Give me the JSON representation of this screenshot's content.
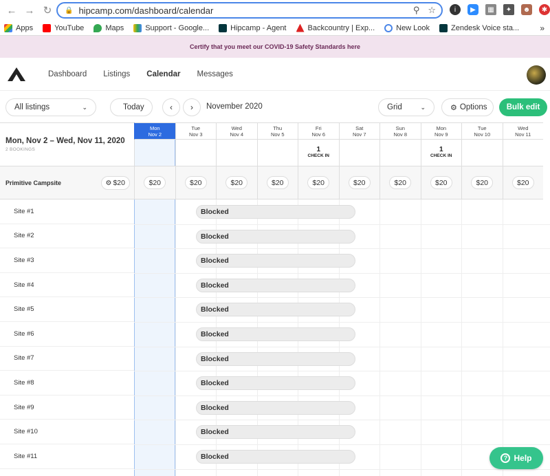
{
  "browser": {
    "url": "hipcamp.com/dashboard/calendar",
    "bookmarks": [
      "Apps",
      "YouTube",
      "Maps",
      "Support - Google...",
      "Hipcamp - Agent",
      "Backcountry | Exp...",
      "New Look",
      "Zendesk Voice sta..."
    ]
  },
  "banner": {
    "text": "Certify that you meet our COVID-19 Safety Standards here"
  },
  "nav": {
    "items": [
      "Dashboard",
      "Listings",
      "Calendar",
      "Messages"
    ],
    "active": "Calendar"
  },
  "toolbar": {
    "listings_select": "All listings",
    "today_label": "Today",
    "month_label": "November 2020",
    "view_select": "Grid",
    "options_label": "Options",
    "bulk_edit_label": "Bulk edit"
  },
  "calendar": {
    "range": "Mon, Nov 2 – Wed, Nov 11, 2020",
    "bookings": "2 BOOKINGS",
    "days": [
      {
        "dow": "Mon",
        "date": "Nov 2"
      },
      {
        "dow": "Tue",
        "date": "Nov 3"
      },
      {
        "dow": "Wed",
        "date": "Nov 4"
      },
      {
        "dow": "Thu",
        "date": "Nov 5"
      },
      {
        "dow": "Fri",
        "date": "Nov 6"
      },
      {
        "dow": "Sat",
        "date": "Nov 7"
      },
      {
        "dow": "Sun",
        "date": "Nov 8"
      },
      {
        "dow": "Mon",
        "date": "Nov 9"
      },
      {
        "dow": "Tue",
        "date": "Nov 10"
      },
      {
        "dow": "Wed",
        "date": "Nov 11"
      }
    ],
    "checkins": [
      {
        "count": "1",
        "label": "CHECK IN"
      },
      {
        "count": "1",
        "label": "CHECK IN"
      }
    ],
    "campsite": {
      "name": "Primitive Campsite",
      "base_price": "$20"
    },
    "day_prices": [
      "$20",
      "$20",
      "$20",
      "$20",
      "$20",
      "$20",
      "$20",
      "$20",
      "$20",
      "$20"
    ],
    "sites": [
      "Site #1",
      "Site #2",
      "Site #3",
      "Site #4",
      "Site #5",
      "Site #6",
      "Site #7",
      "Site #8",
      "Site #9",
      "Site #10",
      "Site #11"
    ],
    "blocked_label": "Blocked"
  },
  "help": {
    "label": "Help"
  }
}
